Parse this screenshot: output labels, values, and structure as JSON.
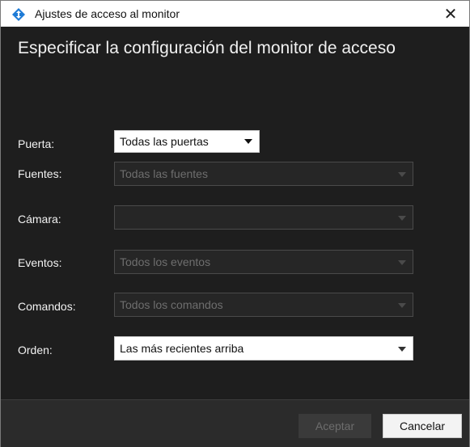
{
  "window": {
    "title": "Ajustes de acceso al monitor",
    "close_glyph": "✕",
    "app_icon": "blue-diamond-logo-icon"
  },
  "heading": "Especificar la configuración del monitor de acceso",
  "fields": {
    "puerta": {
      "label": "Puerta:",
      "value": "Todas las puertas",
      "enabled": true
    },
    "fuentes": {
      "label": "Fuentes:",
      "value": "Todas las fuentes",
      "enabled": false
    },
    "camara": {
      "label": "Cámara:",
      "value": "",
      "enabled": false
    },
    "eventos": {
      "label": "Eventos:",
      "value": "Todos los eventos",
      "enabled": false
    },
    "comandos": {
      "label": "Comandos:",
      "value": "Todos los comandos",
      "enabled": false
    },
    "orden": {
      "label": "Orden:",
      "value": "Las más recientes arriba",
      "enabled": true
    }
  },
  "footer": {
    "accept_label": "Aceptar",
    "accept_enabled": false,
    "cancel_label": "Cancelar"
  },
  "colors": {
    "accent_icon": "#1e7bd6",
    "background": "#1e1e1e",
    "footer": "#2b2b2b"
  }
}
